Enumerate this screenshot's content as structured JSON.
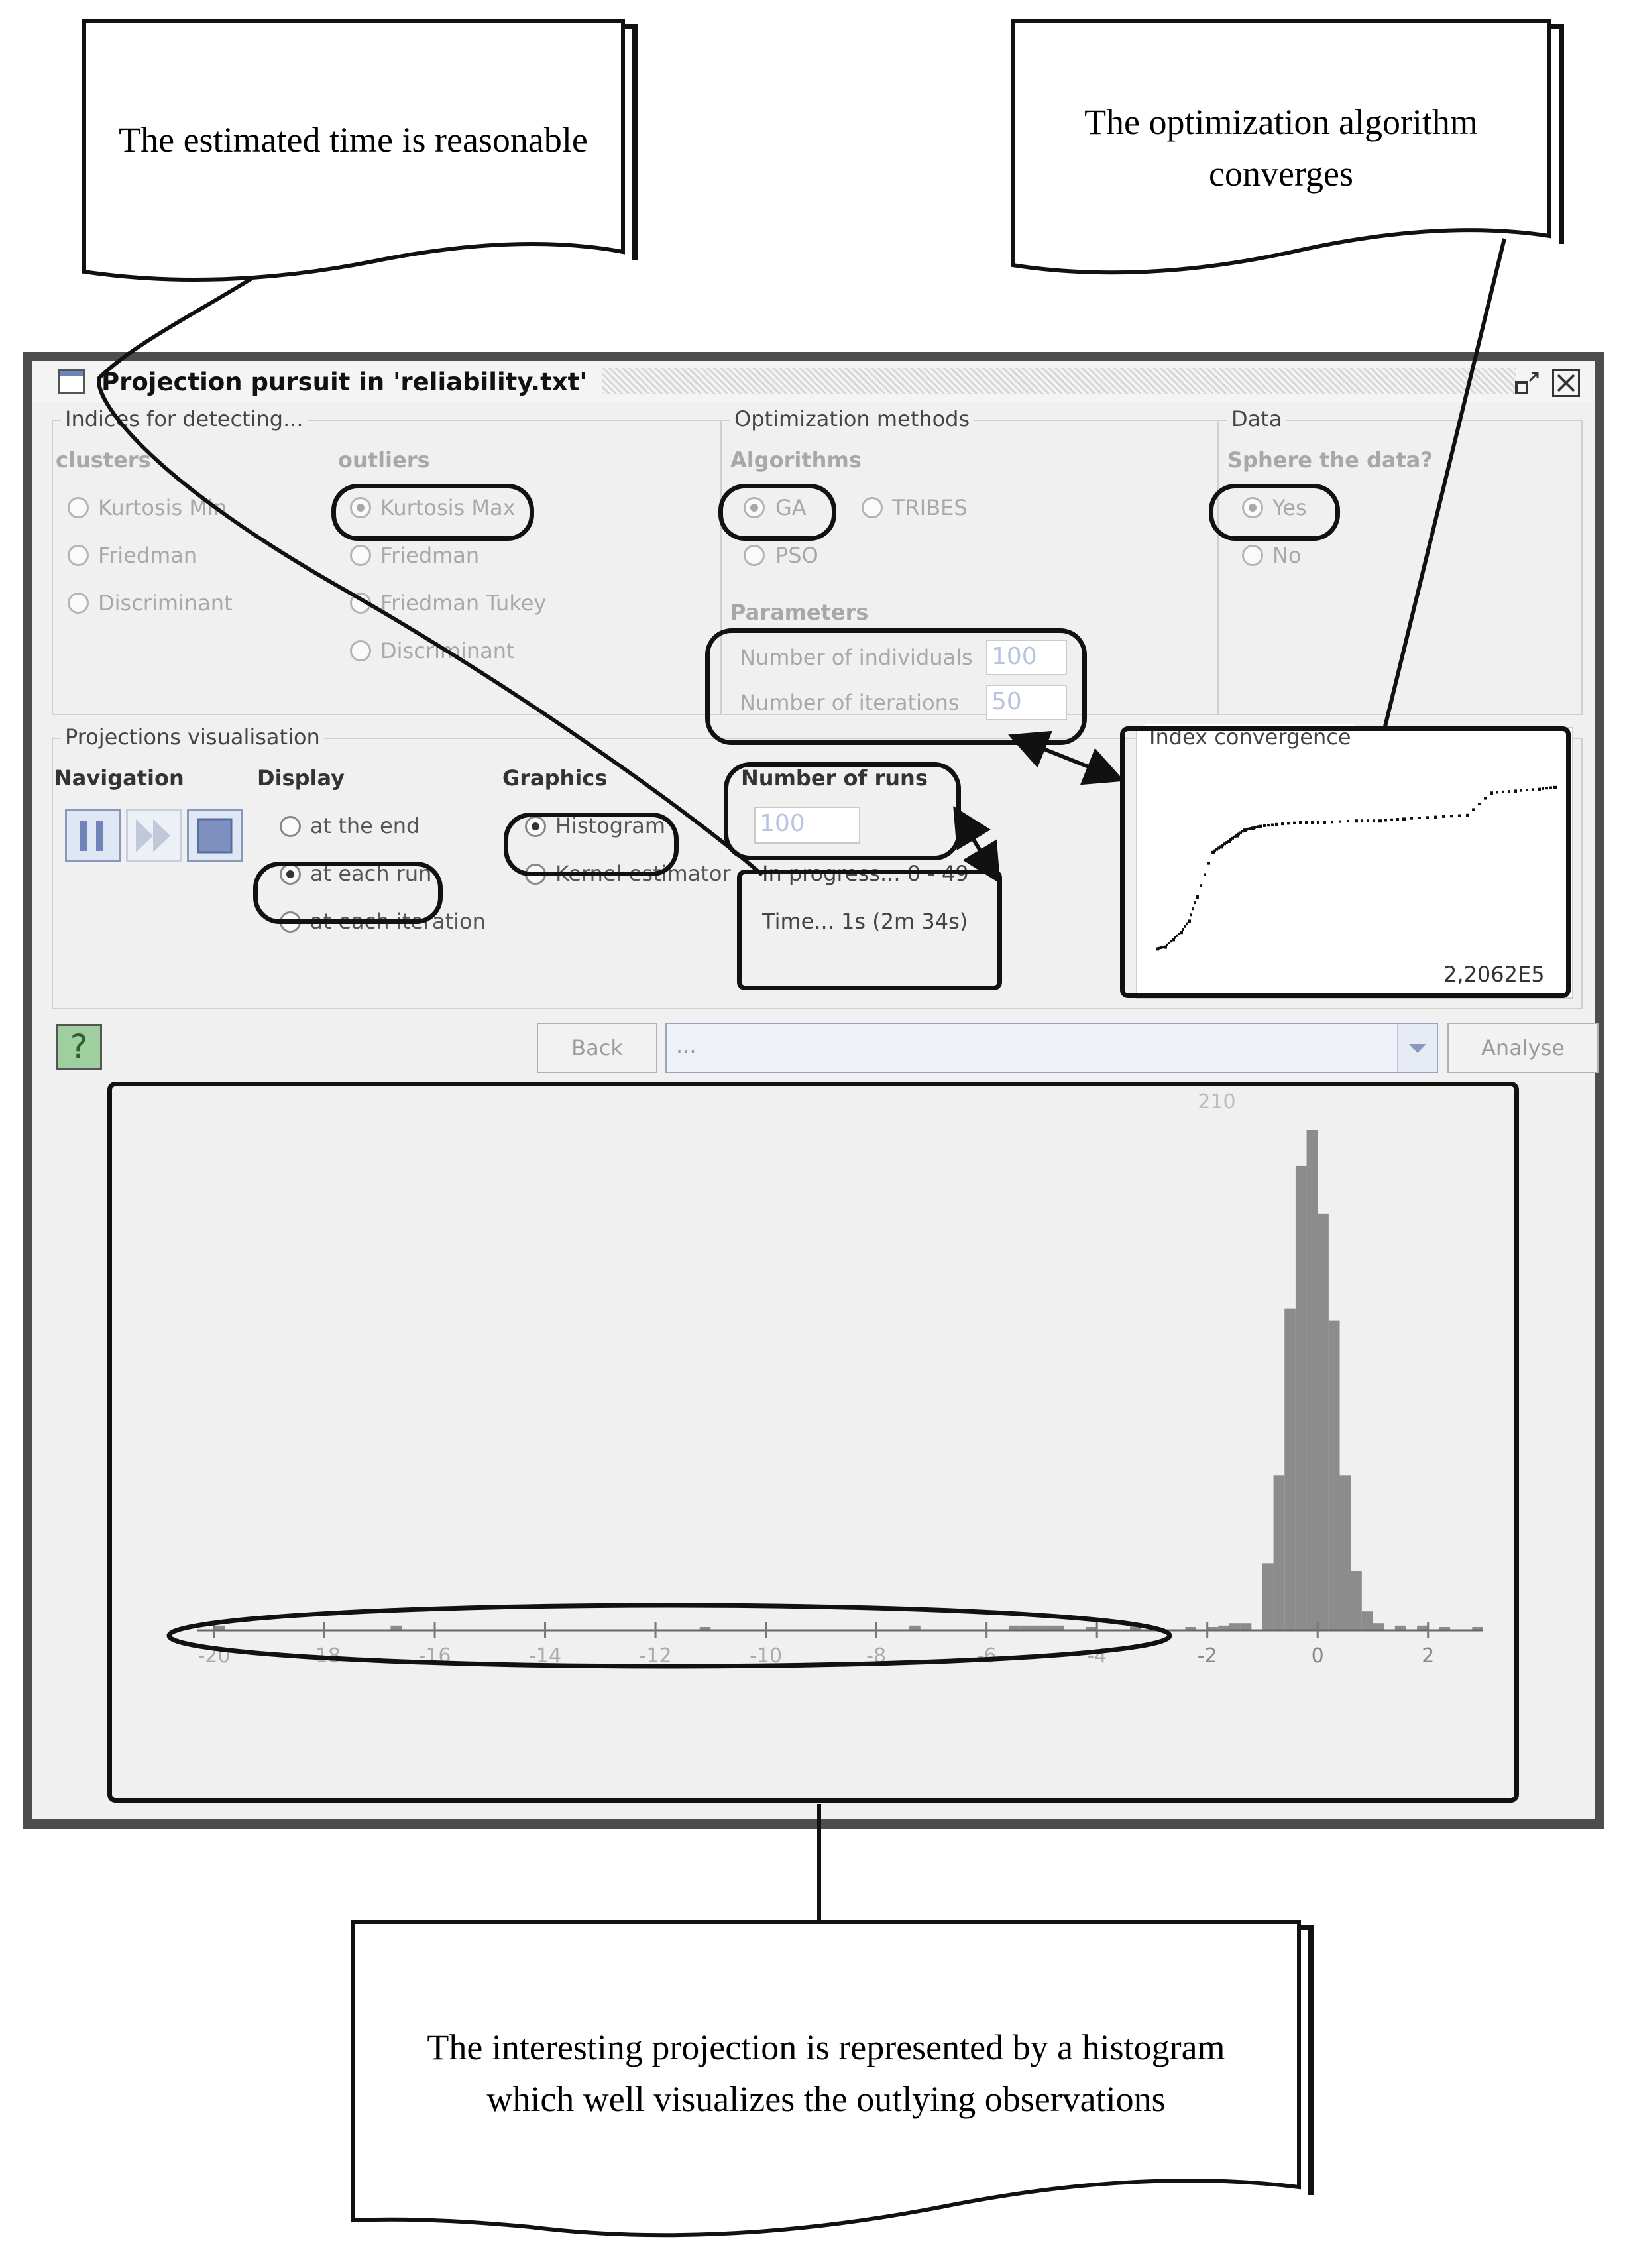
{
  "callouts": {
    "time": "The estimated time is reasonable",
    "converge_line1": "The optimization algorithm",
    "converge_line2": "converges",
    "histogram_line1": "The interesting projection is represented by a histogram",
    "histogram_line2": "which well visualizes the outlying observations"
  },
  "window": {
    "title": "Projection pursuit in 'reliability.txt'",
    "icons": [
      "window-icon",
      "restore-icon",
      "close-icon"
    ]
  },
  "indices": {
    "title": "Indices for detecting...",
    "clusters_label": "clusters",
    "outliers_label": "outliers",
    "clusters": [
      {
        "label": "Kurtosis Min",
        "selected": false
      },
      {
        "label": "Friedman",
        "selected": false
      },
      {
        "label": "Discriminant",
        "selected": false
      }
    ],
    "outliers": [
      {
        "label": "Kurtosis Max",
        "selected": true
      },
      {
        "label": "Friedman",
        "selected": false
      },
      {
        "label": "Friedman Tukey",
        "selected": false
      },
      {
        "label": "Discriminant",
        "selected": false
      }
    ]
  },
  "optimization": {
    "title": "Optimization methods",
    "algorithms_label": "Algorithms",
    "algorithms": [
      {
        "label": "GA",
        "selected": true
      },
      {
        "label": "TRIBES",
        "selected": false
      },
      {
        "label": "PSO",
        "selected": false
      }
    ],
    "parameters_label": "Parameters",
    "individuals_label": "Number of individuals",
    "individuals_value": "100",
    "iterations_label": "Number of iterations",
    "iterations_value": "50"
  },
  "data_panel": {
    "title": "Data",
    "sphere_label": "Sphere the data?",
    "options": [
      {
        "label": "Yes",
        "selected": true
      },
      {
        "label": "No",
        "selected": false
      }
    ]
  },
  "visualisation": {
    "title": "Projections visualisation",
    "navigation_label": "Navigation",
    "nav_icons": [
      "pause-icon",
      "fast-forward-icon",
      "stop-icon"
    ],
    "display_label": "Display",
    "display": [
      {
        "label": "at the end",
        "selected": false
      },
      {
        "label": "at each run",
        "selected": true
      },
      {
        "label": "at each iteration",
        "selected": false
      }
    ],
    "graphics_label": "Graphics",
    "graphics": [
      {
        "label": "Histogram",
        "selected": true
      },
      {
        "label": "Kernel estimator",
        "selected": false
      }
    ],
    "runs_label": "Number of runs",
    "runs_value": "100",
    "progress_text": "In progress... 0 - 49",
    "time_text": "Time... 1s (2m 34s)"
  },
  "convergence": {
    "title": "Index convergence",
    "value": "2,2062E5",
    "points": [
      [
        0.0,
        0.02
      ],
      [
        0.02,
        0.03
      ],
      [
        0.04,
        0.07
      ],
      [
        0.06,
        0.11
      ],
      [
        0.08,
        0.17
      ],
      [
        0.1,
        0.3
      ],
      [
        0.14,
        0.54
      ],
      [
        0.16,
        0.57
      ],
      [
        0.18,
        0.6
      ],
      [
        0.2,
        0.63
      ],
      [
        0.22,
        0.66
      ],
      [
        0.24,
        0.67
      ],
      [
        0.26,
        0.68
      ],
      [
        0.3,
        0.69
      ],
      [
        0.36,
        0.7
      ],
      [
        0.42,
        0.7
      ],
      [
        0.5,
        0.71
      ],
      [
        0.56,
        0.71
      ],
      [
        0.62,
        0.72
      ],
      [
        0.7,
        0.73
      ],
      [
        0.78,
        0.74
      ],
      [
        0.84,
        0.86
      ],
      [
        0.9,
        0.87
      ],
      [
        0.96,
        0.88
      ],
      [
        1.0,
        0.89
      ]
    ]
  },
  "bottom_bar": {
    "help_icon": "help-icon",
    "back_label": "Back",
    "combo_value": "...",
    "analyse_label": "Analyse"
  },
  "chart_data": {
    "type": "bar",
    "title": "",
    "xlabel": "",
    "ylabel": "",
    "peak_label": "210",
    "x_ticks": [
      -20,
      -18,
      -16,
      -14,
      -12,
      -10,
      -8,
      -6,
      -4,
      -2,
      0,
      2
    ],
    "xlim": [
      -20.3,
      3.0
    ],
    "ylim": [
      0,
      210
    ],
    "bin_width": 0.2,
    "bins": [
      {
        "x": -20.0,
        "count": 2
      },
      {
        "x": -16.8,
        "count": 2
      },
      {
        "x": -11.2,
        "count": 1
      },
      {
        "x": -7.4,
        "count": 2
      },
      {
        "x": -5.6,
        "count": 2
      },
      {
        "x": -5.4,
        "count": 2
      },
      {
        "x": -5.2,
        "count": 2
      },
      {
        "x": -5.0,
        "count": 2
      },
      {
        "x": -4.8,
        "count": 2
      },
      {
        "x": -4.2,
        "count": 1
      },
      {
        "x": -3.4,
        "count": 2
      },
      {
        "x": -2.4,
        "count": 1
      },
      {
        "x": -2.0,
        "count": 1
      },
      {
        "x": -1.8,
        "count": 2
      },
      {
        "x": -1.6,
        "count": 3
      },
      {
        "x": -1.4,
        "count": 3
      },
      {
        "x": -1.0,
        "count": 28
      },
      {
        "x": -0.8,
        "count": 65
      },
      {
        "x": -0.6,
        "count": 135
      },
      {
        "x": -0.4,
        "count": 195
      },
      {
        "x": -0.2,
        "count": 210
      },
      {
        "x": 0.0,
        "count": 175
      },
      {
        "x": 0.2,
        "count": 130
      },
      {
        "x": 0.4,
        "count": 65
      },
      {
        "x": 0.6,
        "count": 25
      },
      {
        "x": 0.8,
        "count": 8
      },
      {
        "x": 1.0,
        "count": 3
      },
      {
        "x": 1.4,
        "count": 2
      },
      {
        "x": 1.8,
        "count": 2
      },
      {
        "x": 2.2,
        "count": 1
      },
      {
        "x": 2.8,
        "count": 1
      }
    ]
  }
}
